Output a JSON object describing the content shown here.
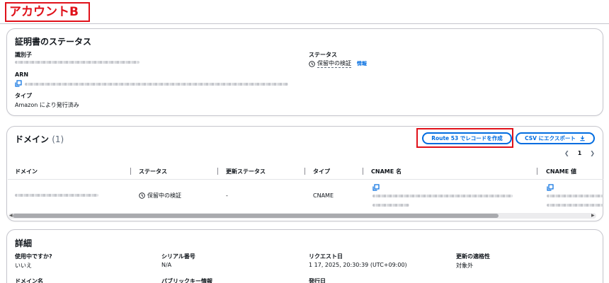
{
  "account": {
    "label": "アカウントB"
  },
  "cert_status": {
    "title": "証明書のステータス",
    "identifier_label": "識別子",
    "status_label": "ステータス",
    "status_value": "保留中の検証",
    "info_link": "情報",
    "arn_label": "ARN",
    "type_label": "タイプ",
    "type_value": "Amazon により発行済み"
  },
  "domains": {
    "title": "ドメイン",
    "count": "(1)",
    "route53_button": "Route 53 でレコードを作成",
    "export_button": "CSV にエクスポート",
    "page": "1",
    "columns": [
      "ドメイン",
      "ステータス",
      "更新ステータス",
      "タイプ",
      "CNAME 名",
      "CNAME 値"
    ],
    "row": {
      "status": "保留中の検証",
      "renewal_status": "-",
      "type": "CNAME"
    }
  },
  "details": {
    "title": "詳細",
    "in_use_label": "使用中ですか?",
    "in_use_value": "いいえ",
    "serial_label": "シリアル番号",
    "serial_value": "N/A",
    "requested_label": "リクエスト日",
    "requested_value": "1 17, 2025, 20:30:39 (UTC+09:00)",
    "renewal_label": "更新の適格性",
    "renewal_value": "対象外",
    "domain_name_label": "ドメイン名",
    "public_key_label": "パブリックキー情報",
    "issued_label": "発行日"
  },
  "colors": {
    "accent": "#006ce0",
    "highlight": "#e0111a",
    "border": "#c6c6cd"
  },
  "icons": [
    "copy-icon",
    "clock-icon",
    "download-icon",
    "chevron-left-icon",
    "chevron-right-icon"
  ]
}
